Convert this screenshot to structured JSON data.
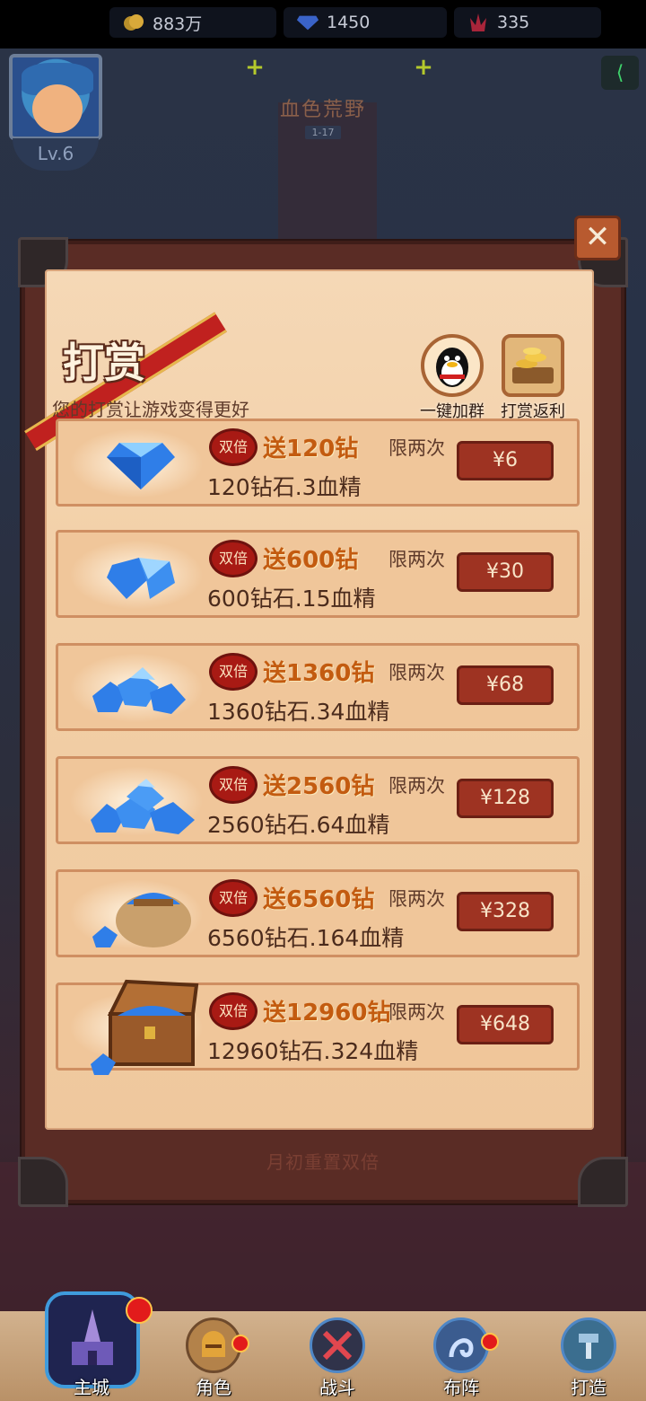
{
  "topbar": {
    "gold": "883万",
    "diamonds": "1450",
    "stamina": "335",
    "level": "Lv.6",
    "stage_name": "血色荒野",
    "stage_num": "1-17"
  },
  "dialog": {
    "title": "打赏",
    "subtitle": "您的打赏让游戏变得更好",
    "close_label": "✕",
    "side_buttons": [
      {
        "label": "一键加群",
        "icon": "penguin-icon"
      },
      {
        "label": "打赏返利",
        "icon": "gold-coins-icon"
      }
    ],
    "rows": [
      {
        "badge": "双倍",
        "bonus": "送120钻",
        "limit": "限两次",
        "desc": "120钻石.3血精",
        "price": "¥6"
      },
      {
        "badge": "双倍",
        "bonus": "送600钻",
        "limit": "限两次",
        "desc": "600钻石.15血精",
        "price": "¥30"
      },
      {
        "badge": "双倍",
        "bonus": "送1360钻",
        "limit": "限两次",
        "desc": "1360钻石.34血精",
        "price": "¥68"
      },
      {
        "badge": "双倍",
        "bonus": "送2560钻",
        "limit": "限两次",
        "desc": "2560钻石.64血精",
        "price": "¥128"
      },
      {
        "badge": "双倍",
        "bonus": "送6560钻",
        "limit": "限两次",
        "desc": "6560钻石.164血精",
        "price": "¥328"
      },
      {
        "badge": "双倍",
        "bonus": "送12960钻",
        "limit": "限两次",
        "desc": "12960钻石.324血精",
        "price": "¥648"
      }
    ],
    "footer_note": "月初重置双倍"
  },
  "nav": {
    "items": [
      {
        "label": "主城",
        "icon": "castle-icon"
      },
      {
        "label": "角色",
        "icon": "knight-helmet-icon"
      },
      {
        "label": "战斗",
        "icon": "crossed-swords-icon"
      },
      {
        "label": "布阵",
        "icon": "formation-icon"
      },
      {
        "label": "打造",
        "icon": "forge-hammer-icon"
      }
    ]
  },
  "colors": {
    "accent": "#c35b10",
    "price_button": "#9e3322",
    "badge": "#a81a14",
    "parchment": "#f2cfa6"
  }
}
